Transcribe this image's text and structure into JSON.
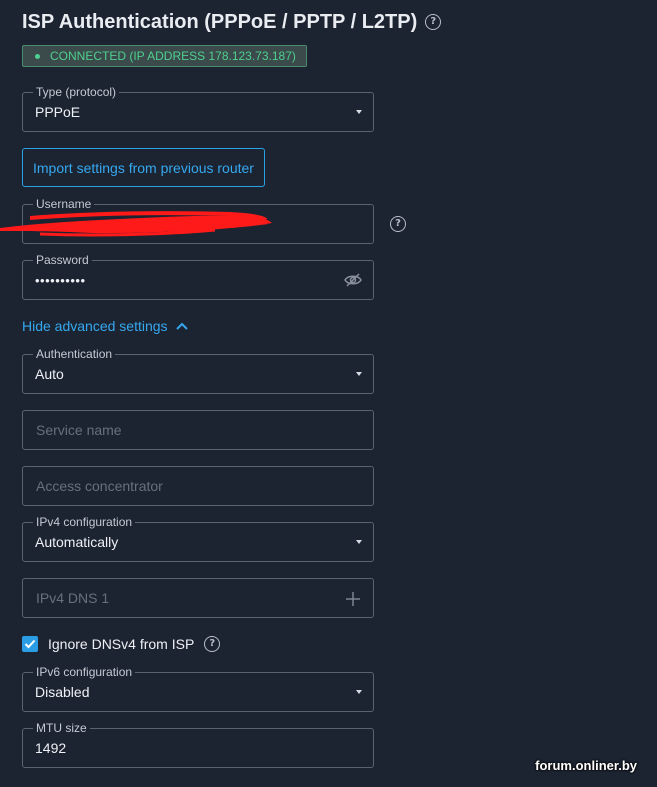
{
  "page": {
    "title": "ISP Authentication (PPPoE / PPTP / L2TP)",
    "status": "CONNECTED (IP ADDRESS 178.123.73.187)"
  },
  "form": {
    "type_label": "Type (protocol)",
    "type_value": "PPPoE",
    "import_button": "Import settings from previous router",
    "username_label": "Username",
    "username_value": "",
    "password_label": "Password",
    "password_value": "••••••••••",
    "advanced_toggle": "Hide advanced settings",
    "authentication_label": "Authentication",
    "authentication_value": "Auto",
    "service_name_placeholder": "Service name",
    "access_concentrator_placeholder": "Access concentrator",
    "ipv4_config_label": "IPv4 configuration",
    "ipv4_config_value": "Automatically",
    "ipv4_dns_placeholder": "IPv4 DNS 1",
    "ignore_dns_label": "Ignore DNSv4 from ISP",
    "ignore_dns_checked": true,
    "ipv6_config_label": "IPv6 configuration",
    "ipv6_config_value": "Disabled",
    "mtu_label": "MTU size",
    "mtu_value": "1492"
  },
  "watermark": "forum.onliner.by",
  "icons": [
    "help-icon",
    "status-dot-icon",
    "chevron-down-icon",
    "eye-off-icon",
    "chevron-up-icon",
    "plus-icon",
    "check-icon"
  ],
  "colors": {
    "background": "#1c2331",
    "accent": "#35a9f0",
    "status_green": "#4fd08f",
    "redaction": "#ff1a1a"
  }
}
